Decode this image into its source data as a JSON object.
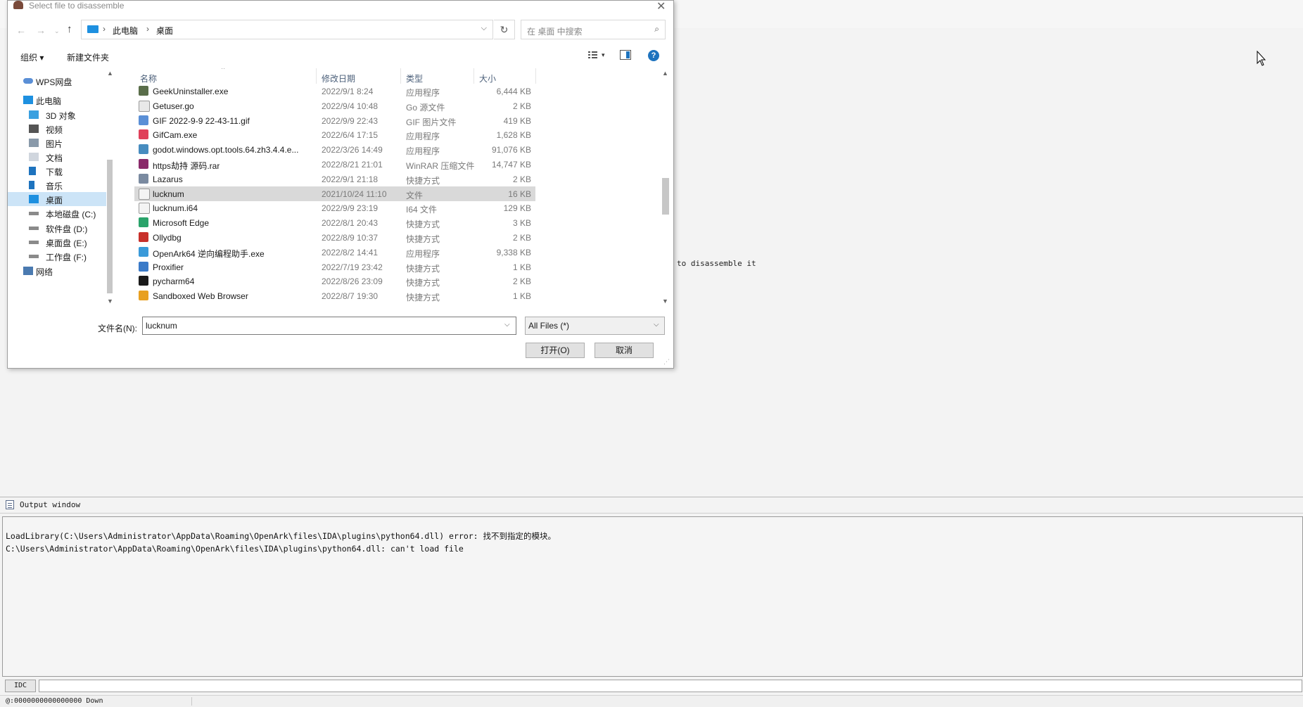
{
  "dialog": {
    "title": "Select file to disassemble",
    "close_glyph": "✕",
    "nav": {
      "back": "←",
      "forward": "→",
      "recent": "⌄",
      "up": "↑"
    },
    "address": {
      "crumbs": [
        "此电脑",
        "桌面"
      ],
      "sep": "›",
      "dropdown": "⌵",
      "refresh": "↻"
    },
    "search": {
      "placeholder": "在 桌面 中搜索",
      "icon": "⌕"
    },
    "toolbar": {
      "organize": "组织 ▾",
      "new_folder": "新建文件夹",
      "view_dropdown": "▾",
      "help": "?"
    },
    "nav_pane": {
      "items": [
        {
          "label": "WPS网盘",
          "icon": "cloud-icon"
        },
        {
          "label": "此电脑",
          "icon": "computer-icon"
        },
        {
          "label": "3D 对象",
          "icon": "cube-icon"
        },
        {
          "label": "视频",
          "icon": "video-icon"
        },
        {
          "label": "图片",
          "icon": "picture-icon"
        },
        {
          "label": "文档",
          "icon": "document-icon"
        },
        {
          "label": "下载",
          "icon": "download-icon"
        },
        {
          "label": "音乐",
          "icon": "music-icon"
        },
        {
          "label": "桌面",
          "icon": "desktop-icon",
          "selected": true
        },
        {
          "label": "本地磁盘 (C:)",
          "icon": "drive-icon"
        },
        {
          "label": "软件盘 (D:)",
          "icon": "drive-icon"
        },
        {
          "label": "桌面盘 (E:)",
          "icon": "drive-icon"
        },
        {
          "label": "工作盘 (F:)",
          "icon": "drive-icon"
        },
        {
          "label": "网络",
          "icon": "network-icon"
        }
      ],
      "scroll_up": "▲",
      "scroll_down": "▼"
    },
    "columns": {
      "name": "名称",
      "date": "修改日期",
      "type": "类型",
      "size": "大小",
      "sort_arrow": "^"
    },
    "files": [
      {
        "name": "GeekUninstaller.exe",
        "date": "2022/9/1 8:24",
        "type": "应用程序",
        "size": "6,444 KB",
        "icon_color": "#5a6e4a"
      },
      {
        "name": "Getuser.go",
        "date": "2022/9/4 10:48",
        "type": "Go 源文件",
        "size": "2 KB",
        "icon_color": "#e8e8e8"
      },
      {
        "name": "GIF 2022-9-9 22-43-11.gif",
        "date": "2022/9/9 22:43",
        "type": "GIF 图片文件",
        "size": "419 KB",
        "icon_color": "#5a8fd6"
      },
      {
        "name": "GifCam.exe",
        "date": "2022/6/4 17:15",
        "type": "应用程序",
        "size": "1,628 KB",
        "icon_color": "#e0405a"
      },
      {
        "name": "godot.windows.opt.tools.64.zh3.4.4.e...",
        "date": "2022/3/26 14:49",
        "type": "应用程序",
        "size": "91,076 KB",
        "icon_color": "#478cbf"
      },
      {
        "name": "https劫持 源码.rar",
        "date": "2022/8/21 21:01",
        "type": "WinRAR 压缩文件",
        "size": "14,747 KB",
        "icon_color": "#8a2a6a"
      },
      {
        "name": "Lazarus",
        "date": "2022/9/1 21:18",
        "type": "快捷方式",
        "size": "2 KB",
        "icon_color": "#7a8aa0"
      },
      {
        "name": "lucknum",
        "date": "2021/10/24 11:10",
        "type": "文件",
        "size": "16 KB",
        "icon_color": "#f4f4f4",
        "selected": true
      },
      {
        "name": "lucknum.i64",
        "date": "2022/9/9 23:19",
        "type": "I64 文件",
        "size": "129 KB",
        "icon_color": "#f4f4f4"
      },
      {
        "name": "Microsoft Edge",
        "date": "2022/8/1 20:43",
        "type": "快捷方式",
        "size": "3 KB",
        "icon_color": "#2aa36a"
      },
      {
        "name": "Ollydbg",
        "date": "2022/8/9 10:37",
        "type": "快捷方式",
        "size": "2 KB",
        "icon_color": "#c8302a"
      },
      {
        "name": "OpenArk64 逆向编程助手.exe",
        "date": "2022/8/2 14:41",
        "type": "应用程序",
        "size": "9,338 KB",
        "icon_color": "#3a9ad9"
      },
      {
        "name": "Proxifier",
        "date": "2022/7/19 23:42",
        "type": "快捷方式",
        "size": "1 KB",
        "icon_color": "#3a7ac8"
      },
      {
        "name": "pycharm64",
        "date": "2022/8/26 23:09",
        "type": "快捷方式",
        "size": "2 KB",
        "icon_color": "#1a1a1a"
      },
      {
        "name": "Sandboxed Web Browser",
        "date": "2022/8/7 19:30",
        "type": "快捷方式",
        "size": "1 KB",
        "icon_color": "#e8a020"
      }
    ],
    "filename_label": "文件名(N):",
    "filename_value": "lucknum",
    "filetype_value": "All Files  (*)",
    "dropdown_glyph": "⌵",
    "open_label": "打开(O)",
    "cancel_label": "取消",
    "list_scroll_up": "▲",
    "list_scroll_down": "▼",
    "resize_grip": "⋰"
  },
  "ida": {
    "hint_text": "to disassemble it",
    "output_window_title": "Output window",
    "output_lines": [
      "LoadLibrary(C:\\Users\\Administrator\\AppData\\Roaming\\OpenArk\\files\\IDA\\plugins\\python64.dll) error: 找不到指定的模块。",
      "C:\\Users\\Administrator\\AppData\\Roaming\\OpenArk\\files\\IDA\\plugins\\python64.dll: can't load file"
    ],
    "idc_label": "IDC",
    "status_text": "@:0000000000000000 Down"
  },
  "colors": {
    "selection": "#cce4f7",
    "accent": "#1e73be"
  }
}
